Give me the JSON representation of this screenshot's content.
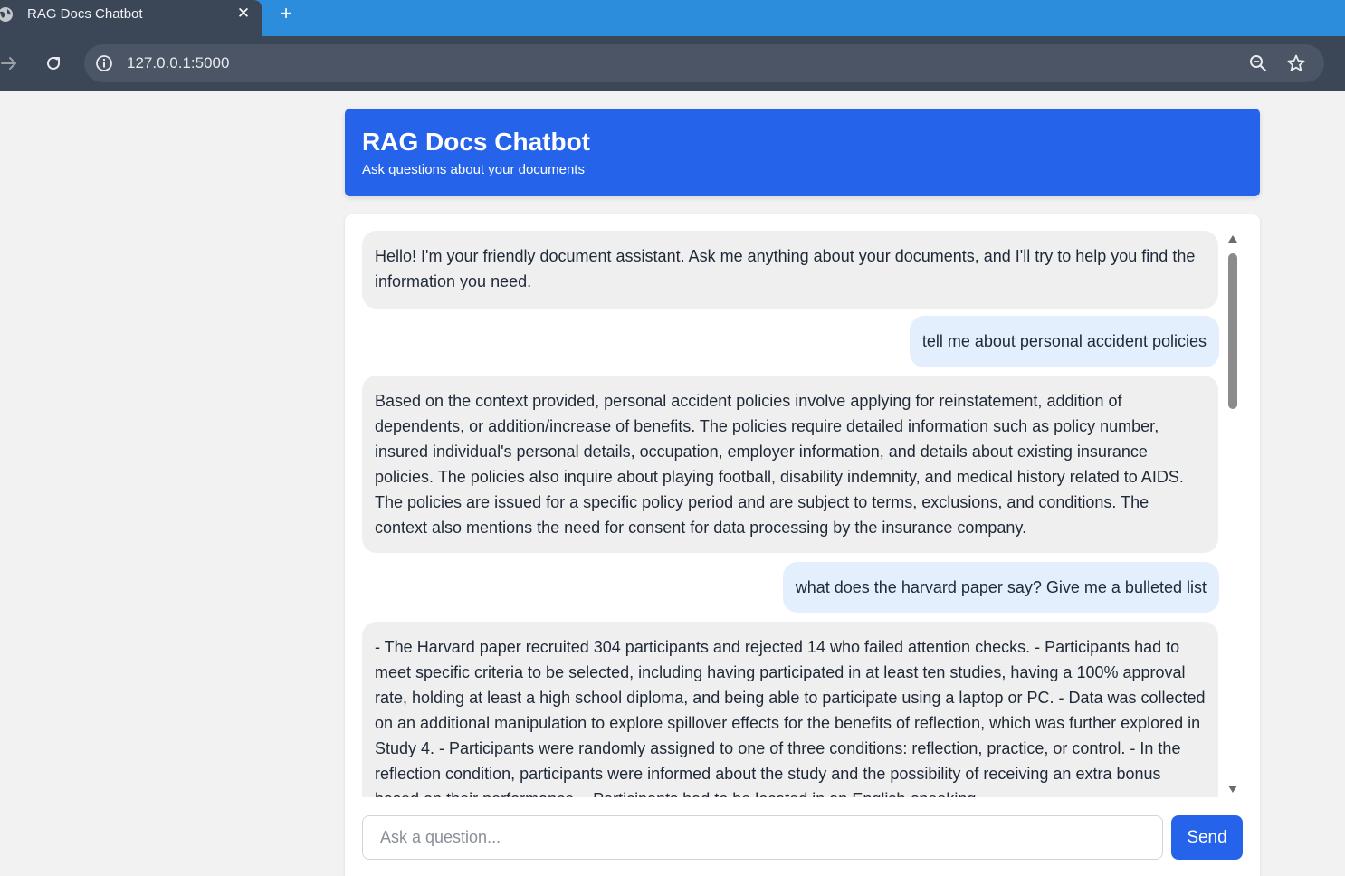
{
  "browser": {
    "tab_title": "RAG Docs Chatbot",
    "tab_close": "✕",
    "new_tab": "+",
    "url": "127.0.0.1:5000",
    "icons": [
      "globe-icon",
      "close-icon",
      "plus-icon",
      "forward-icon",
      "reload-icon",
      "info-icon",
      "zoom-icon",
      "star-icon"
    ]
  },
  "header": {
    "title": "RAG Docs Chatbot",
    "subtitle": "Ask questions about your documents"
  },
  "messages": [
    {
      "role": "bot",
      "text": "Hello! I'm your friendly document assistant. Ask me anything about your documents, and I'll try to help you find the information you need."
    },
    {
      "role": "user",
      "text": "tell me about personal accident policies"
    },
    {
      "role": "bot",
      "text": "Based on the context provided, personal accident policies involve applying for reinstatement, addition of dependents, or addition/increase of benefits. The policies require detailed information such as policy number, insured individual's personal details, occupation, employer information, and details about existing insurance policies. The policies also inquire about playing football, disability indemnity, and medical history related to AIDS. The policies are issued for a specific policy period and are subject to terms, exclusions, and conditions. The context also mentions the need for consent for data processing by the insurance company."
    },
    {
      "role": "user",
      "text": "what does the harvard paper say? Give me a bulleted list"
    },
    {
      "role": "bot",
      "text": "- The Harvard paper recruited 304 participants and rejected 14 who failed attention checks. - Participants had to meet specific criteria to be selected, including having participated in at least ten studies, having a 100% approval rate, holding at least a high school diploma, and being able to participate using a laptop or PC. - Data was collected on an additional manipulation to explore spillover effects for the benefits of reflection, which was further explored in Study 4. - Participants were randomly assigned to one of three conditions: reflection, practice, or control. - In the reflection condition, participants were informed about the study and the possibility of receiving an extra bonus based on their performance. - Participants had to be located in an English-speaking"
    }
  ],
  "input": {
    "placeholder": "Ask a question...",
    "value": ""
  },
  "send_label": "Send",
  "colors": {
    "accent": "#2563eb",
    "bot_bubble": "#efefef",
    "user_bubble": "#e3effd",
    "tab_bar": "#2b8ddb",
    "chrome": "#3b4657"
  }
}
